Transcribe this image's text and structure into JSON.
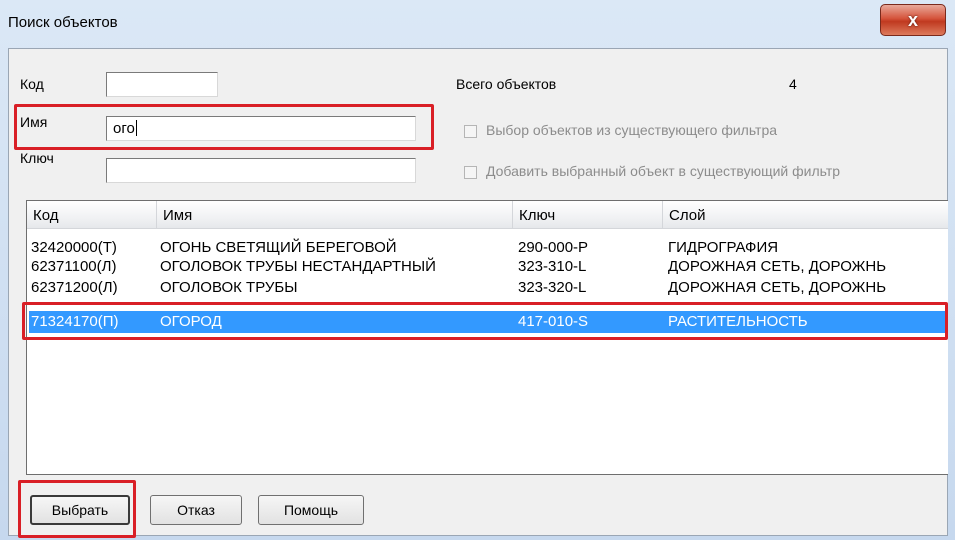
{
  "window": {
    "title": "Поиск объектов",
    "close_glyph": "x"
  },
  "form": {
    "code_label": "Код",
    "code_value": "",
    "name_label": "Имя",
    "name_value": "ого",
    "key_label": "Ключ",
    "key_value": "",
    "total_label": "Всего объектов",
    "total_value": "4",
    "checkbox_filter_label": "Выбор объектов из существующего фильтра",
    "checkbox_add_label": "Добавить выбранный объект в существующий фильтр"
  },
  "table": {
    "columns": [
      "Код",
      "Имя",
      "Ключ",
      "Слой"
    ],
    "rows": [
      {
        "code": "32420000(Т)",
        "name": "ОГОНЬ СВЕТЯЩИЙ БЕРЕГОВОЙ",
        "key": "290-000-Р",
        "layer": "ГИДРОГРАФИЯ"
      },
      {
        "code": "62371100(Л)",
        "name": "ОГОЛОВОК ТРУБЫ НЕСТАНДАРТНЫЙ",
        "key": "323-310-L",
        "layer": "ДОРОЖНАЯ СЕТЬ, ДОРОЖНЬ"
      },
      {
        "code": "62371200(Л)",
        "name": "ОГОЛОВОК ТРУБЫ",
        "key": "323-320-L",
        "layer": "ДОРОЖНАЯ СЕТЬ, ДОРОЖНЬ"
      },
      {
        "code": "71324170(П)",
        "name": "ОГОРОД",
        "key": "417-010-S",
        "layer": "РАСТИТЕЛЬНОСТЬ"
      }
    ],
    "selected_index": 3
  },
  "buttons": {
    "select": "Выбрать",
    "cancel": "Отказ",
    "help": "Помощь"
  },
  "colors": {
    "highlight": "#d91f26",
    "selection": "#3399ff"
  }
}
